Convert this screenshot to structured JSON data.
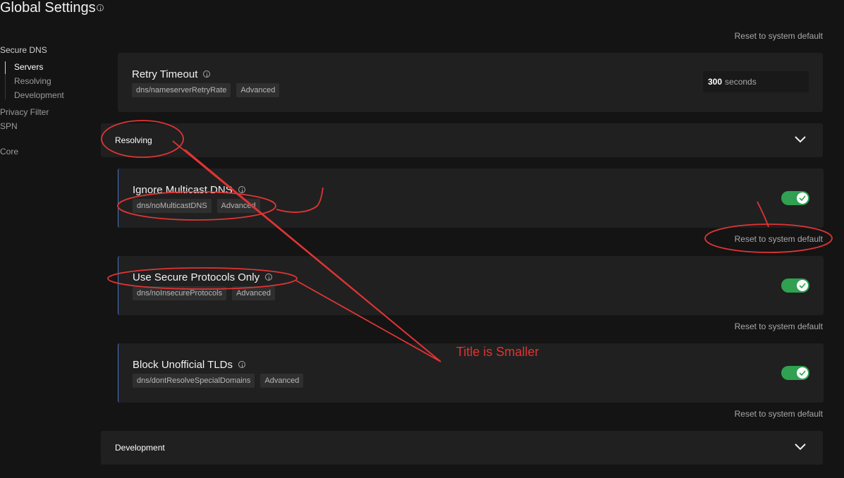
{
  "page": {
    "title": "Global Settings"
  },
  "nav": {
    "items": [
      {
        "label": "Secure DNS"
      },
      {
        "label": "Servers"
      },
      {
        "label": "Resolving"
      },
      {
        "label": "Development"
      },
      {
        "label": "Privacy Filter"
      },
      {
        "label": "SPN"
      },
      {
        "label": "Core"
      }
    ]
  },
  "reset_label": "Reset to system default",
  "settings": [
    {
      "title": "Retry Timeout",
      "key": "dns/nameserverRetryRate",
      "badge": "Advanced",
      "value": "300",
      "unit": "seconds"
    },
    {
      "title": "Ignore Multicast DNS",
      "key": "dns/noMulticastDNS",
      "badge": "Advanced",
      "enabled": true
    },
    {
      "title": "Use Secure Protocols Only",
      "key": "dns/noInsecureProtocols",
      "badge": "Advanced",
      "enabled": true
    },
    {
      "title": "Block Unofficial TLDs",
      "key": "dns/dontResolveSpecialDomains",
      "badge": "Advanced",
      "enabled": true
    }
  ],
  "sections": [
    {
      "title": "Resolving"
    },
    {
      "title": "Development"
    }
  ],
  "annotation": {
    "text": "Title is Smaller",
    "color": "#e03434"
  },
  "colors": {
    "toggle_on": "#2fa151",
    "accent_border": "#4a73c8",
    "background": "#141414",
    "card": "#202020"
  }
}
